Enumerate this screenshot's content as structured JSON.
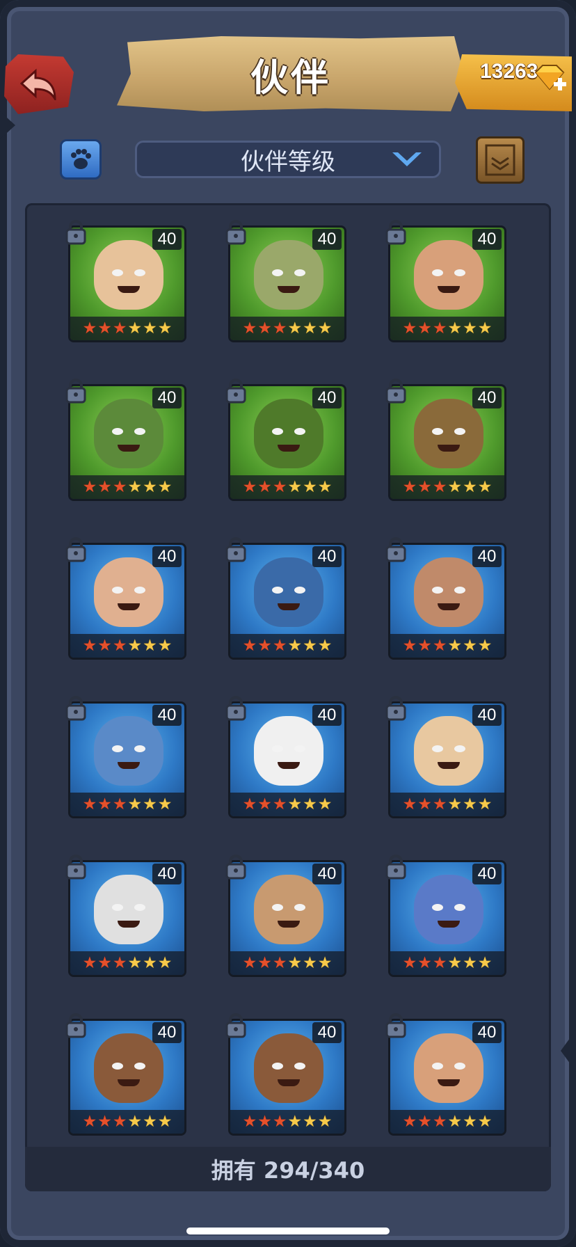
{
  "header": {
    "title": "伙伴",
    "gems": "13263"
  },
  "controls": {
    "sort_label": "伙伴等级"
  },
  "colors": {
    "accent_gold": "#f7c94a",
    "star_red": "#e5502a",
    "panel": "#2b3347"
  },
  "grid": {
    "cards": [
      {
        "level": "40",
        "stars_red": 3,
        "stars_total": 6,
        "theme": "green",
        "skin": "#e7c29a",
        "icon": "skull-helmet-huntress"
      },
      {
        "level": "40",
        "stars_red": 3,
        "stars_total": 6,
        "theme": "green",
        "skin": "#9aa86a",
        "icon": "scarecrow"
      },
      {
        "level": "40",
        "stars_red": 3,
        "stars_total": 6,
        "theme": "green",
        "skin": "#d8a07a",
        "icon": "bone-crown-warrior"
      },
      {
        "level": "40",
        "stars_red": 3,
        "stars_total": 6,
        "theme": "green",
        "skin": "#5c8a3a",
        "icon": "horned-beast"
      },
      {
        "level": "40",
        "stars_red": 3,
        "stars_total": 6,
        "theme": "green",
        "skin": "#4f7a2a",
        "icon": "swamp-monster"
      },
      {
        "level": "40",
        "stars_red": 3,
        "stars_total": 6,
        "theme": "green",
        "skin": "#8a6a3a",
        "icon": "tree-golem"
      },
      {
        "level": "40",
        "stars_red": 3,
        "stars_total": 6,
        "theme": "blue",
        "skin": "#e0b090",
        "icon": "fox-ninja"
      },
      {
        "level": "40",
        "stars_red": 3,
        "stars_total": 6,
        "theme": "blue",
        "skin": "#3a6aa8",
        "icon": "blue-dragon"
      },
      {
        "level": "40",
        "stars_red": 3,
        "stars_total": 6,
        "theme": "blue",
        "skin": "#c08a6a",
        "icon": "pirate-minotaur"
      },
      {
        "level": "40",
        "stars_red": 3,
        "stars_total": 6,
        "theme": "blue",
        "skin": "#5a8ac8",
        "icon": "shark"
      },
      {
        "level": "40",
        "stars_red": 3,
        "stars_total": 6,
        "theme": "blue",
        "skin": "#f0f0f0",
        "icon": "panda"
      },
      {
        "level": "40",
        "stars_red": 3,
        "stars_total": 6,
        "theme": "blue",
        "skin": "#e8c8a0",
        "icon": "goat-girl"
      },
      {
        "level": "40",
        "stars_red": 3,
        "stars_total": 6,
        "theme": "blue",
        "skin": "#e0e0e0",
        "icon": "masked-ghost"
      },
      {
        "level": "40",
        "stars_red": 3,
        "stars_total": 6,
        "theme": "blue",
        "skin": "#c89a70",
        "icon": "goblin"
      },
      {
        "level": "40",
        "stars_red": 3,
        "stars_total": 6,
        "theme": "blue",
        "skin": "#5a7ac8",
        "icon": "water-spirit"
      },
      {
        "level": "40",
        "stars_red": 3,
        "stars_total": 6,
        "theme": "blue",
        "skin": "#8a5a3a",
        "icon": "armored-brute"
      },
      {
        "level": "40",
        "stars_red": 3,
        "stars_total": 6,
        "theme": "blue",
        "skin": "#8a5a3a",
        "icon": "armored-brute"
      },
      {
        "level": "40",
        "stars_red": 3,
        "stars_total": 6,
        "theme": "blue",
        "skin": "#d8a07a",
        "icon": "bone-crown-warrior"
      }
    ]
  },
  "footer": {
    "owned_text": "拥有 294/340"
  }
}
